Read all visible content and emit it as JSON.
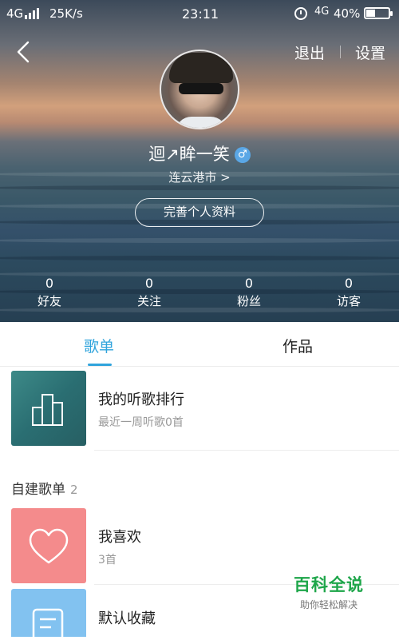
{
  "status_bar": {
    "network": "4G",
    "speed": "25K/s",
    "time": "23:11",
    "network_right": "4G",
    "battery": "40%",
    "battery_level": 0.4
  },
  "header": {
    "logout_label": "退出",
    "settings_label": "设置"
  },
  "profile": {
    "name": "迴↗眸一笑",
    "gender_symbol": "♂",
    "city": "连云港市 >",
    "complete_button": "完善个人资料"
  },
  "stats": [
    {
      "value": "0",
      "label": "好友"
    },
    {
      "value": "0",
      "label": "关注"
    },
    {
      "value": "0",
      "label": "粉丝"
    },
    {
      "value": "0",
      "label": "访客"
    }
  ],
  "tabs": [
    {
      "label": "歌单",
      "active": true
    },
    {
      "label": "作品",
      "active": false
    }
  ],
  "ranking": {
    "title": "我的听歌排行",
    "subtitle": "最近一周听歌0首"
  },
  "section": {
    "title": "自建歌单",
    "count": "2"
  },
  "playlists": [
    {
      "title": "我喜欢",
      "subtitle": "3首"
    },
    {
      "title": "默认收藏",
      "subtitle": ""
    }
  ],
  "watermark": {
    "title": "百科全说",
    "subtitle": "助你轻松解决"
  },
  "colors": {
    "accent": "#31a4dc",
    "like_tile": "#f48b8c",
    "collect_tile": "#82c2f0",
    "rank_tile": "#2a6e72",
    "watermark": "#1ea64a"
  }
}
